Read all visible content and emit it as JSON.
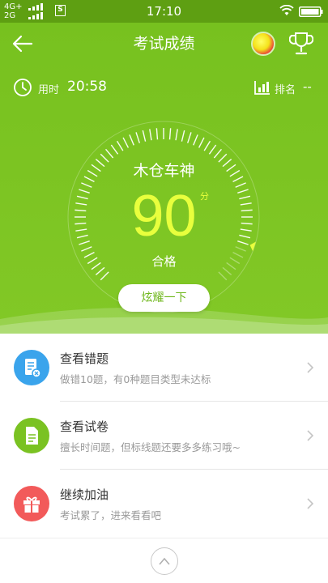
{
  "status_bar": {
    "network_1": "4G+",
    "network_2": "2G",
    "sim_label": "S",
    "time": "17:10"
  },
  "header": {
    "title": "考试成绩",
    "back_icon": "arrow-left-icon",
    "avatar_icon": "ball-avatar",
    "trophy_icon": "trophy-icon"
  },
  "stats": {
    "time_label": "用时",
    "time_value": "20:58",
    "rank_label": "排名",
    "rank_value": "--"
  },
  "result": {
    "honor_title": "木仓车神",
    "score": "90",
    "score_unit": "分",
    "pass_label": "合格",
    "score_fraction": 0.9,
    "share_button": "炫耀一下"
  },
  "menu": {
    "items": [
      {
        "title": "查看错题",
        "desc": "做错10题，有0种题目类型未达标",
        "color": "#3aa4ec",
        "icon": "wrong-questions-icon"
      },
      {
        "title": "查看试卷",
        "desc": "擅长时间题，但标线题还要多多练习哦~",
        "color": "#7ac222",
        "icon": "exam-paper-icon"
      },
      {
        "title": "继续加油",
        "desc": "考试累了，进来看看吧",
        "color": "#f25a5a",
        "icon": "gift-icon"
      }
    ]
  },
  "colors": {
    "primary_green": "#77c11f",
    "score_yellow": "#e8ff3d"
  }
}
